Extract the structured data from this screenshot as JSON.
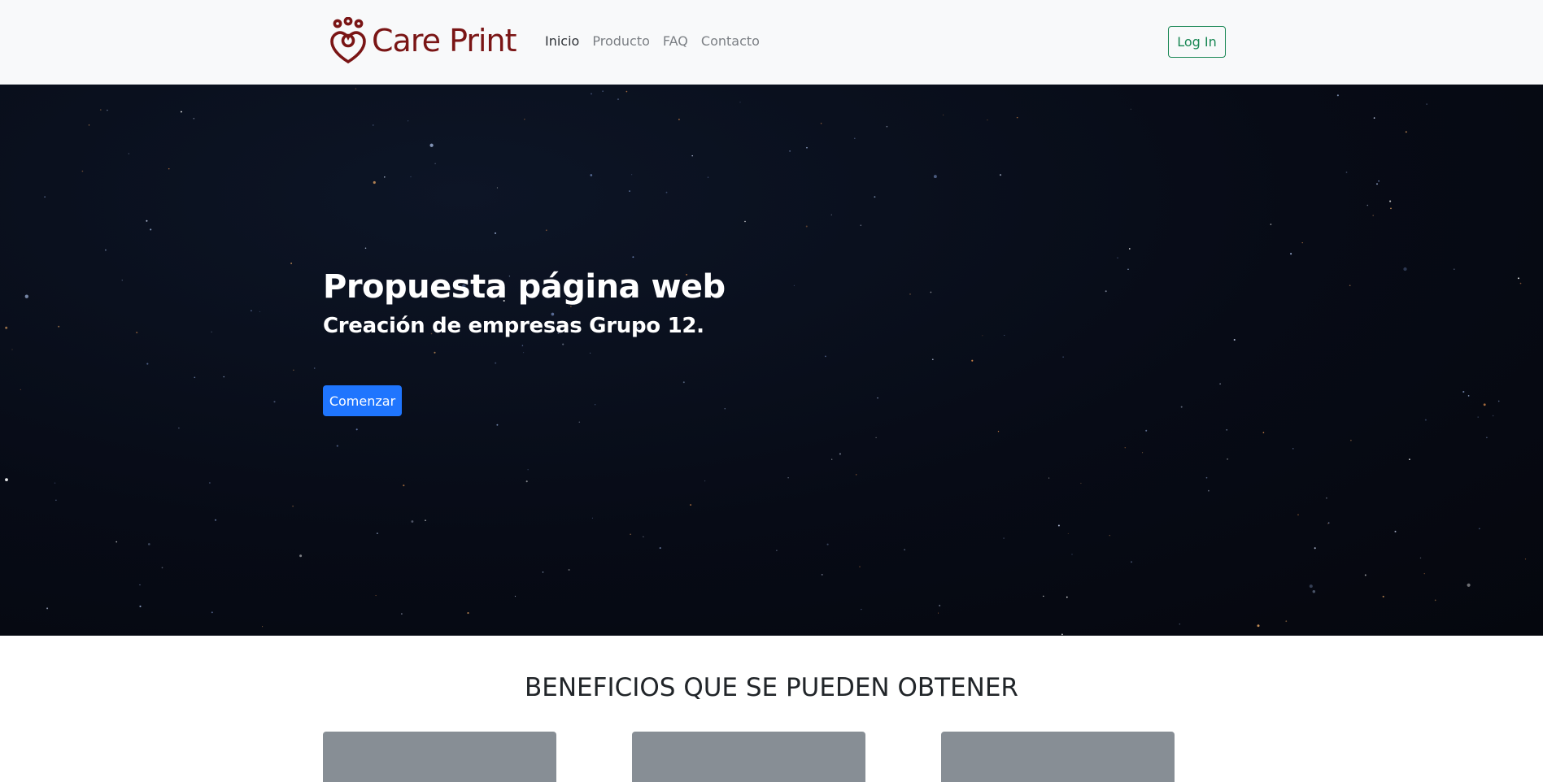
{
  "brand": {
    "name": "Care Print",
    "color": "#7a1515",
    "logo_icon": "paw-heart-icon"
  },
  "nav": {
    "items": [
      {
        "label": "Inicio",
        "active": true
      },
      {
        "label": "Producto",
        "active": false
      },
      {
        "label": "FAQ",
        "active": false
      },
      {
        "label": "Contacto",
        "active": false
      }
    ],
    "login_label": "Log In"
  },
  "hero": {
    "title": "Propuesta página web",
    "subtitle": "Creación de empresas Grupo 12.",
    "cta_label": "Comenzar"
  },
  "benefits": {
    "title": "BENEFICIOS QUE SE PUEDEN OBTENER",
    "cards": [
      {
        "placeholder_color": "#878e95"
      },
      {
        "placeholder_color": "#878e95"
      },
      {
        "placeholder_color": "#878e95"
      }
    ]
  },
  "colors": {
    "navbar_bg": "#f8f9fa",
    "success": "#198754",
    "primary": "#1f75fe",
    "hero_bg": "#070b16"
  }
}
